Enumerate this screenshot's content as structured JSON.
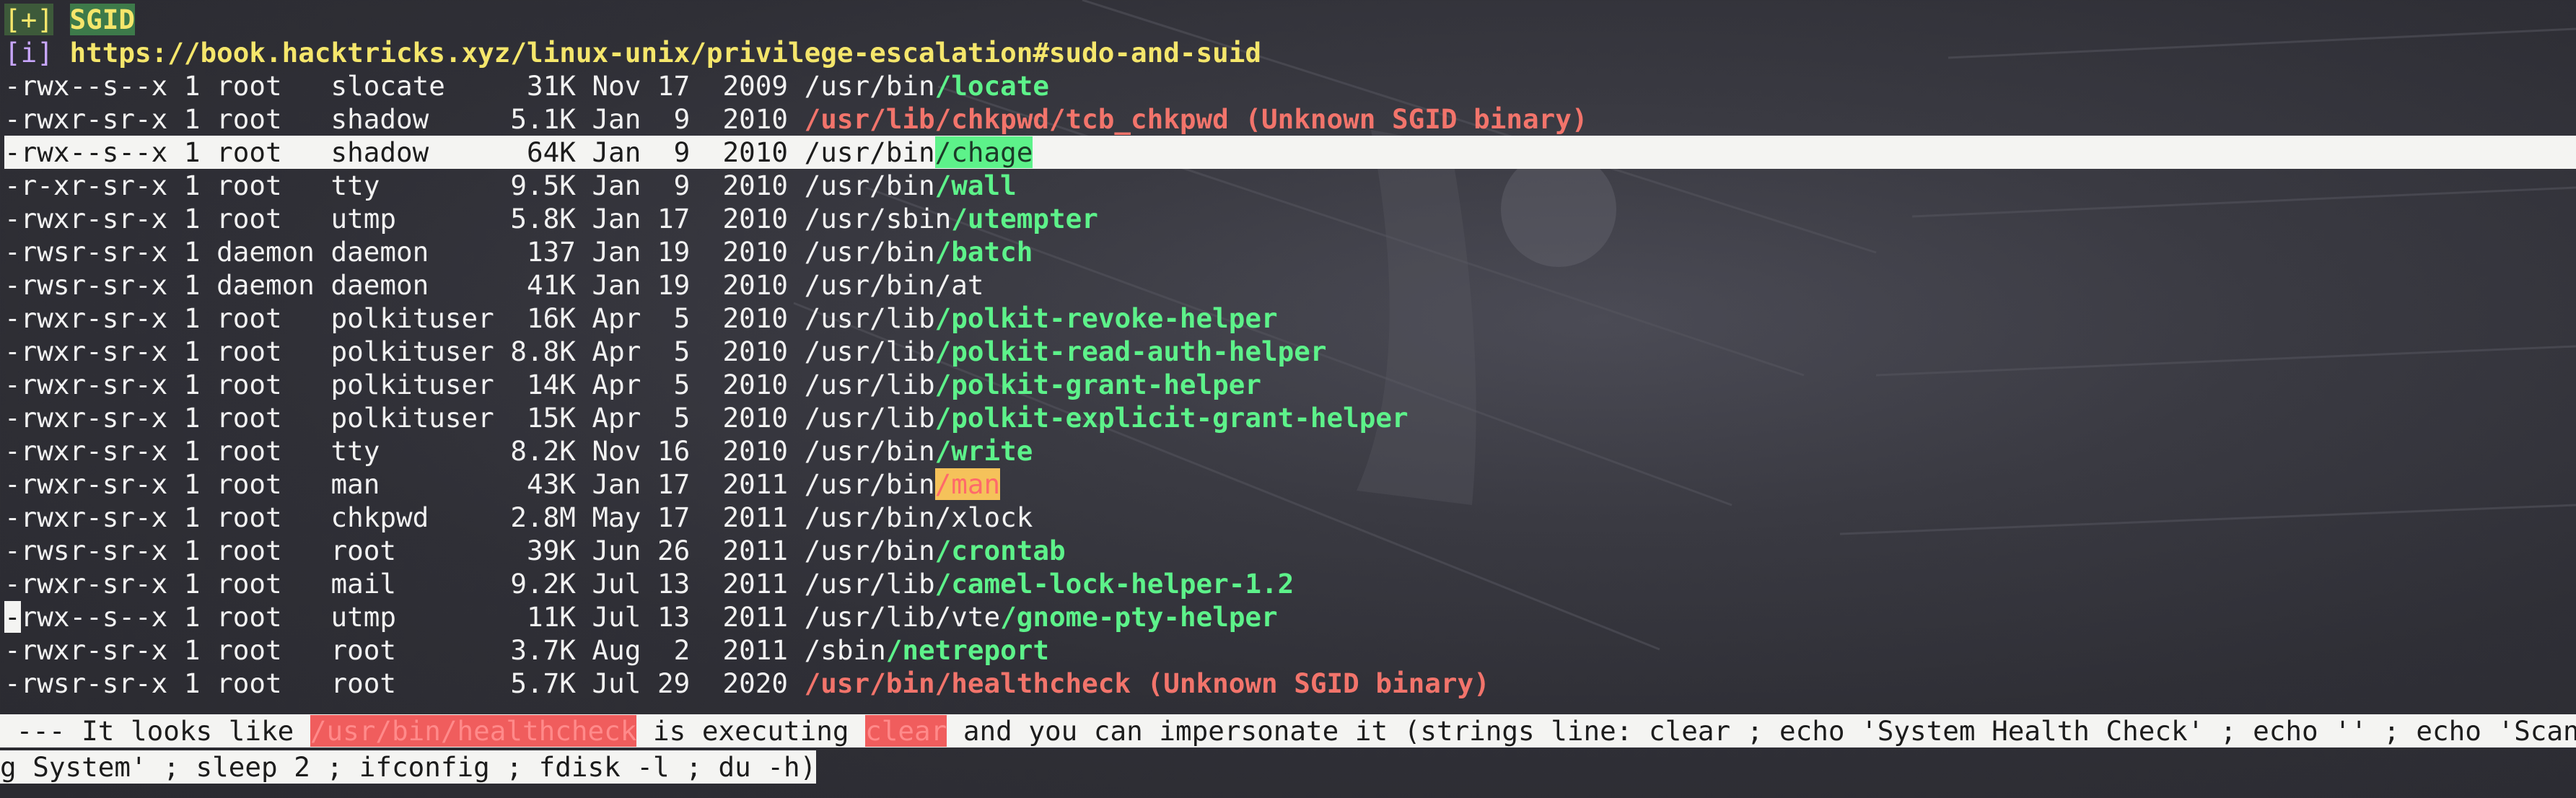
{
  "header": {
    "tag_plus": "[+]",
    "title": "SGID",
    "tag_info": "[i]",
    "url": "https://book.hacktricks.xyz/linux-unix/privilege-escalation#sudo-and-suid"
  },
  "rows": [
    {
      "meta": "-rwx--s--x 1 root   slocate     31K Nov 17  2009 ",
      "dir": "/usr/bin",
      "name": "/locate",
      "style": "green",
      "note": ""
    },
    {
      "meta": "-rwxr-sr-x 1 root   shadow     5.1K Jan  9  2010 ",
      "dir": "",
      "name": "/usr/lib/chkpwd/tcb_chkpwd",
      "style": "red",
      "note": " (Unknown SGID binary)"
    },
    {
      "meta": "-rwx--s--x 1 root   shadow      64K Jan  9  2010 ",
      "dir": "/usr/bin",
      "name": "/chage",
      "style": "bg-green",
      "note": ""
    },
    {
      "meta": "-r-xr-sr-x 1 root   tty        9.5K Jan  9  2010 ",
      "dir": "/usr/bin",
      "name": "/wall",
      "style": "green",
      "note": ""
    },
    {
      "meta": "-rwxr-sr-x 1 root   utmp       5.8K Jan 17  2010 ",
      "dir": "/usr/sbin",
      "name": "/utempter",
      "style": "green",
      "note": ""
    },
    {
      "meta": "-rwsr-sr-x 1 daemon daemon      137 Jan 19  2010 ",
      "dir": "/usr/bin",
      "name": "/batch",
      "style": "green",
      "note": ""
    },
    {
      "meta": "-rwsr-sr-x 1 daemon daemon      41K Jan 19  2010 ",
      "dir": "/usr/bin/at",
      "name": "",
      "style": "",
      "note": ""
    },
    {
      "meta": "-rwxr-sr-x 1 root   polkituser  16K Apr  5  2010 ",
      "dir": "/usr/lib",
      "name": "/polkit-revoke-helper",
      "style": "green",
      "note": ""
    },
    {
      "meta": "-rwxr-sr-x 1 root   polkituser 8.8K Apr  5  2010 ",
      "dir": "/usr/lib",
      "name": "/polkit-read-auth-helper",
      "style": "green",
      "note": ""
    },
    {
      "meta": "-rwxr-sr-x 1 root   polkituser  14K Apr  5  2010 ",
      "dir": "/usr/lib",
      "name": "/polkit-grant-helper",
      "style": "green",
      "note": ""
    },
    {
      "meta": "-rwxr-sr-x 1 root   polkituser  15K Apr  5  2010 ",
      "dir": "/usr/lib",
      "name": "/polkit-explicit-grant-helper",
      "style": "green",
      "note": ""
    },
    {
      "meta": "-rwxr-sr-x 1 root   tty        8.2K Nov 16  2010 ",
      "dir": "/usr/bin",
      "name": "/write",
      "style": "green",
      "note": ""
    },
    {
      "meta": "-rwxr-sr-x 1 root   man         43K Jan 17  2011 ",
      "dir": "/usr/bin",
      "name": "/man",
      "style": "bg-yellow-red",
      "note": ""
    },
    {
      "meta": "-rwxr-sr-x 1 root   chkpwd     2.8M May 17  2011 ",
      "dir": "/usr/bin/xlock",
      "name": "",
      "style": "",
      "note": ""
    },
    {
      "meta": "-rwsr-sr-x 1 root   root        39K Jun 26  2011 ",
      "dir": "/usr/bin",
      "name": "/crontab",
      "style": "green",
      "note": ""
    },
    {
      "meta": "-rwxr-sr-x 1 root   mail       9.2K Jul 13  2011 ",
      "dir": "/usr/lib",
      "name": "/camel-lock-helper-1.2",
      "style": "green",
      "note": ""
    },
    {
      "meta": "-rwx--s--x 1 root   utmp        11K Jul 13  2011 ",
      "dir": "/usr/lib/vte",
      "name": "/gnome-pty-helper",
      "style": "green",
      "note": "",
      "cursor": true
    },
    {
      "meta": "-rwxr-sr-x 1 root   root       3.7K Aug  2  2011 ",
      "dir": "/sbin",
      "name": "/netreport",
      "style": "green",
      "note": ""
    },
    {
      "meta": "-rwsr-sr-x 1 root   root       5.7K Jul 29  2020 ",
      "dir": "",
      "name": "/usr/bin/healthcheck",
      "style": "red",
      "note": " (Unknown SGID binary)"
    }
  ],
  "warning": {
    "prefix": " --- It looks like ",
    "binary": "/usr/bin/healthcheck",
    "mid": " is executing ",
    "cmd": "clear",
    "suffix": " and you can impersonate it (strings line: clear ; echo 'System Health Check' ; echo '' ; echo 'Scannin",
    "line2": "g System' ; sleep 2 ; ifconfig ; fdisk -l ; du -h)"
  }
}
